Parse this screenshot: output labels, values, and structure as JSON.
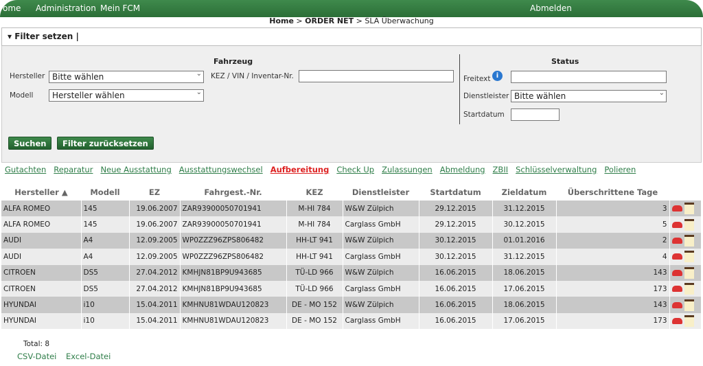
{
  "nav": {
    "items": [
      "ome",
      "Administration",
      "Mein FCM"
    ],
    "logout": "Abmelden"
  },
  "breadcrumb": {
    "home": "Home",
    "sep1": ">",
    "section": "ORDER NET",
    "sep2": ">",
    "page": "SLA Überwachung"
  },
  "filter": {
    "title": "Filter setzen |",
    "fahrzeug": {
      "heading": "Fahrzeug",
      "hersteller_label": "Hersteller",
      "hersteller_value": "Bitte wählen",
      "modell_label": "Modell",
      "modell_value": "Hersteller wählen",
      "kez_label": "KEZ / VIN / Inventar-Nr.",
      "kez_value": ""
    },
    "status": {
      "heading": "Status",
      "freitext_label": "Freitext",
      "freitext_value": "",
      "dienstleister_label": "Dienstleister",
      "dienstleister_value": "Bitte wählen",
      "startdatum_label": "Startdatum",
      "startdatum_value": ""
    },
    "search_button": "Suchen",
    "reset_button": "Filter zurücksetzen"
  },
  "tabs": [
    {
      "label": "Gutachten"
    },
    {
      "label": "Reparatur"
    },
    {
      "label": "Neue Ausstattung"
    },
    {
      "label": "Ausstattungswechsel"
    },
    {
      "label": "Aufbereitung",
      "active": true
    },
    {
      "label": "Check Up"
    },
    {
      "label": "Zulassungen"
    },
    {
      "label": "Abmeldung"
    },
    {
      "label": "ZBII"
    },
    {
      "label": "Schlüsselverwaltung"
    },
    {
      "label": "Polieren"
    }
  ],
  "table": {
    "columns": [
      "Hersteller ▲",
      "Modell",
      "EZ",
      "Fahrgest.-Nr.",
      "KEZ",
      "Dienstleister",
      "Startdatum",
      "Zieldatum",
      "Überschrittene Tage"
    ],
    "rows": [
      [
        "ALFA ROMEO",
        "145",
        "19.06.2007",
        "ZAR93900050701941",
        "M-HI 784",
        "W&W Zülpich",
        "29.12.2015",
        "31.12.2015",
        "3"
      ],
      [
        "ALFA ROMEO",
        "145",
        "19.06.2007",
        "ZAR93900050701941",
        "M-HI 784",
        "Carglass GmbH",
        "29.12.2015",
        "30.12.2015",
        "5"
      ],
      [
        "AUDI",
        "A4",
        "12.09.2005",
        "WP0ZZZ96ZPS806482",
        "HH-LT 941",
        "W&W Zülpich",
        "30.12.2015",
        "01.01.2016",
        "2"
      ],
      [
        "AUDI",
        "A4",
        "12.09.2005",
        "WP0ZZZ96ZPS806482",
        "HH-LT 941",
        "Carglass GmbH",
        "30.12.2015",
        "31.12.2015",
        "4"
      ],
      [
        "CITROEN",
        "DS5",
        "27.04.2012",
        "KMHJN81BP9U943685",
        "TÜ-LD 966",
        "W&W Zülpich",
        "16.06.2015",
        "18.06.2015",
        "143"
      ],
      [
        "CITROEN",
        "DS5",
        "27.04.2012",
        "KMHJN81BP9U943685",
        "TÜ-LD 966",
        "Carglass GmbH",
        "16.06.2015",
        "17.06.2015",
        "173"
      ],
      [
        "HYUNDAI",
        "i10",
        "15.04.2011",
        "KMHNU81WDAU120823",
        "DE - MO 152",
        "W&W Zülpich",
        "16.06.2015",
        "18.06.2015",
        "143"
      ],
      [
        "HYUNDAI",
        "i10",
        "15.04.2011",
        "KMHNU81WDAU120823",
        "DE - MO 152",
        "Carglass GmbH",
        "16.06.2015",
        "17.06.2015",
        "173"
      ]
    ]
  },
  "total": "Total: 8",
  "exports": [
    "CSV-Datei",
    "Excel-Datei"
  ],
  "colors": {
    "nav_green": "#2f7a3e",
    "link_green": "#2e7d48",
    "active_red": "#dd2222",
    "row_dark": "#c8c8c8",
    "row_light": "#ececec"
  }
}
